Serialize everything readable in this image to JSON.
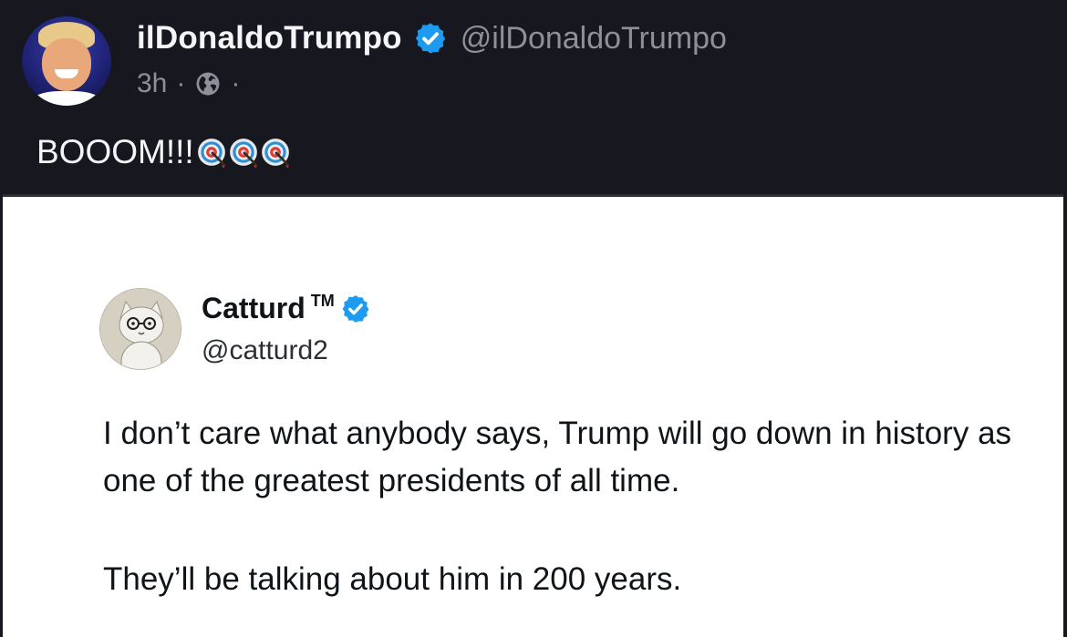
{
  "post": {
    "author": {
      "display_name": "ilDonaldoTrumpo",
      "handle": "@ilDonaldoTrumpo",
      "verified_icon": "verified-badge-icon"
    },
    "meta": {
      "time": "3h",
      "separator": "·",
      "visibility_icon": "globe-icon"
    },
    "text": "BOOOM!!!",
    "emoji": [
      "direct-hit-target-emoji",
      "direct-hit-target-emoji",
      "direct-hit-target-emoji"
    ]
  },
  "embedded_tweet": {
    "author": {
      "name": "Catturd",
      "trademark": "TM",
      "handle": "@catturd2",
      "verified_icon": "verified-badge-icon"
    },
    "body": [
      "I don’t care what anybody says, Trump will go down in history as one of the greatest presidents of all time.",
      "They’ll be talking about him in 200 years."
    ]
  },
  "colors": {
    "background": "#16171f",
    "verified_blue": "#1d9bf0",
    "muted_text": "#8e8f98",
    "embed_background": "#ffffff"
  }
}
